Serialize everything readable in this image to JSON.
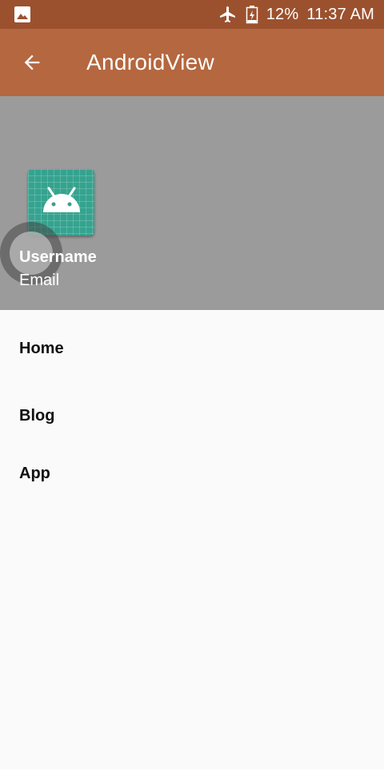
{
  "status_bar": {
    "battery": "12%",
    "time": "11:37 AM",
    "icons": [
      "image-notification-icon",
      "airplane-mode-icon",
      "battery-charging-icon"
    ]
  },
  "app_bar": {
    "title": "AndroidView",
    "back_icon": "arrow-back-icon"
  },
  "drawer_header": {
    "username": "Username",
    "email": "Email",
    "avatar_icon": "android-launcher-icon"
  },
  "menu": {
    "items": [
      {
        "label": "Home"
      },
      {
        "label": "Blog"
      },
      {
        "label": "App"
      }
    ]
  },
  "colors": {
    "status_bar": "#9c512e",
    "app_bar": "#b5673f",
    "drawer_header": "#9b9b9b",
    "avatar": "#35a38f",
    "background": "#fafafa"
  }
}
